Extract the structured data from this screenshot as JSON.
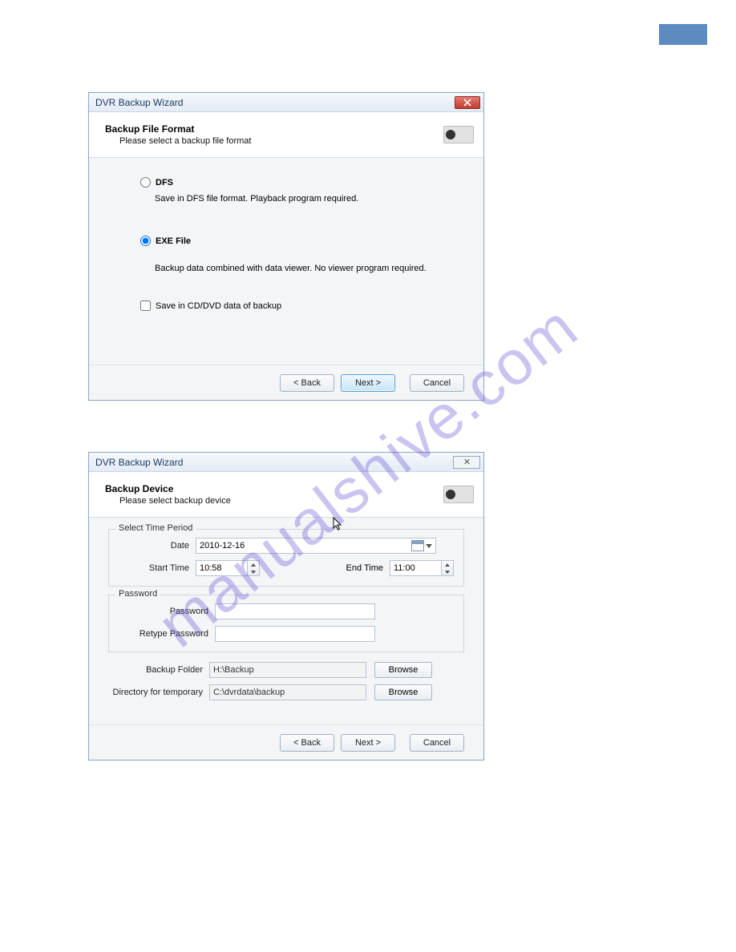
{
  "watermark": "manualshive.com",
  "dialog1": {
    "window_title": "DVR Backup Wizard",
    "heading": "Backup File Format",
    "sub": "Please select a backup file format",
    "opt_dfs_label": "DFS",
    "opt_dfs_desc": "Save in DFS file format. Playback program required.",
    "opt_exe_label": "EXE File",
    "opt_exe_desc": "Backup data combined with data viewer. No viewer program required.",
    "chk_cd_label": "Save in CD/DVD data of backup",
    "btn_back": "< Back",
    "btn_next": "Next >",
    "btn_cancel": "Cancel"
  },
  "dialog2": {
    "window_title": "DVR Backup Wizard",
    "heading": "Backup Device",
    "sub": "Please select backup device",
    "group_time_legend": "Select Time Period",
    "label_date": "Date",
    "value_date": "2010-12-16",
    "label_start": "Start Time",
    "value_start": "10:58",
    "label_end": "End Time",
    "value_end": "11:00",
    "group_pwd_legend": "Password",
    "label_pwd": "Password",
    "label_repwd": "Retype Password",
    "label_folder": "Backup Folder",
    "value_folder": "H:\\Backup",
    "label_temp": "Directory for temporary",
    "value_temp": "C:\\dvrdata\\backup",
    "btn_browse": "Browse",
    "btn_back": "< Back",
    "btn_next": "Next >",
    "btn_cancel": "Cancel"
  }
}
